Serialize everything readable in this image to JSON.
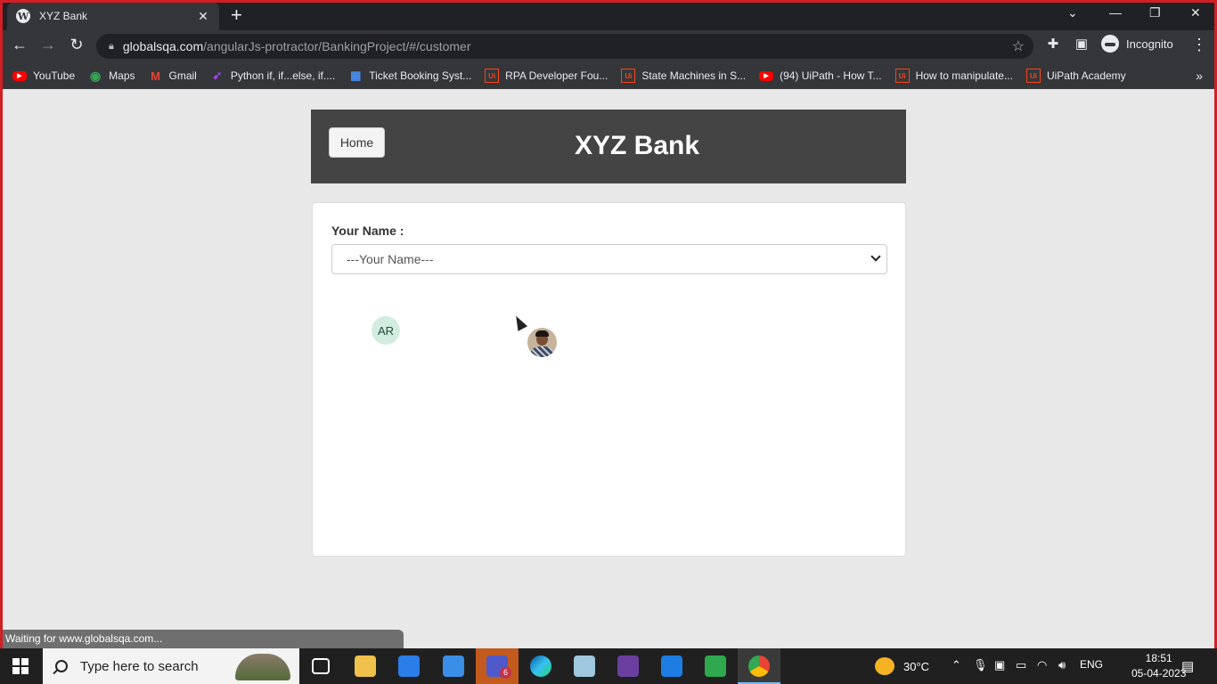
{
  "browser": {
    "tab_title": "XYZ Bank",
    "url_host": "globalsqa.com",
    "url_path": "/angularJs-protractor/BankingProject/#/customer",
    "profile_label": "Incognito",
    "status_text": "Waiting for www.globalsqa.com..."
  },
  "bookmarks": [
    {
      "label": "YouTube",
      "icon": "youtube-icon"
    },
    {
      "label": "Maps",
      "icon": "maps-icon"
    },
    {
      "label": "Gmail",
      "icon": "gmail-icon"
    },
    {
      "label": "Python if, if...else, if....",
      "icon": "python-icon"
    },
    {
      "label": "Ticket Booking Syst...",
      "icon": "ticket-icon"
    },
    {
      "label": "RPA Developer Fou...",
      "icon": "uipath-icon"
    },
    {
      "label": "State Machines in S...",
      "icon": "uipath-icon"
    },
    {
      "label": "(94) UiPath - How T...",
      "icon": "youtube-icon"
    },
    {
      "label": "How to manipulate...",
      "icon": "uipath-icon"
    },
    {
      "label": "UiPath Academy",
      "icon": "uipath-icon"
    }
  ],
  "page": {
    "home_label": "Home",
    "bank_title": "XYZ Bank",
    "name_label": "Your Name :",
    "name_select_value": "---Your Name---",
    "avatar_initials": "AR"
  },
  "taskbar": {
    "search_placeholder": "Type here to search",
    "weather": "30°C",
    "language": "ENG",
    "time": "18:51",
    "date": "05-04-2023",
    "teams_badge": "6"
  },
  "colors": {
    "header_bg": "#444444",
    "page_bg": "#e8e8e8",
    "frame": "#d21f26"
  }
}
